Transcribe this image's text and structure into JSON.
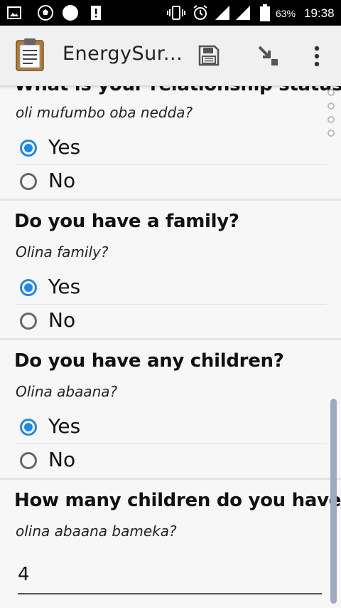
{
  "status_bar": {
    "battery": "63%",
    "time": "19:38"
  },
  "app_bar": {
    "title": "EnergySur...",
    "icons": [
      "clipboard-icon",
      "save-icon",
      "goto-icon",
      "more-vert-icon"
    ]
  },
  "questions": [
    {
      "title": "What is your relationship status?",
      "hint": "oli mufumbo oba nedda?",
      "options": [
        {
          "label": "Yes",
          "checked": true
        },
        {
          "label": "No",
          "checked": false
        }
      ]
    },
    {
      "title": "Do you have a family?",
      "hint": "Olina family?",
      "options": [
        {
          "label": "Yes",
          "checked": true
        },
        {
          "label": "No",
          "checked": false
        }
      ]
    },
    {
      "title": "Do you have any children?",
      "hint": "Olina abaana?",
      "options": [
        {
          "label": "Yes",
          "checked": true
        },
        {
          "label": "No",
          "checked": false
        }
      ]
    },
    {
      "title": "How many children do you have?",
      "hint": "olina abaana bameka?",
      "answer": "4"
    }
  ],
  "colors": {
    "accent": "#1e88e5",
    "status_bar": "#000000",
    "app_bar": "#f0f0f0",
    "background": "#f7f7f7"
  }
}
